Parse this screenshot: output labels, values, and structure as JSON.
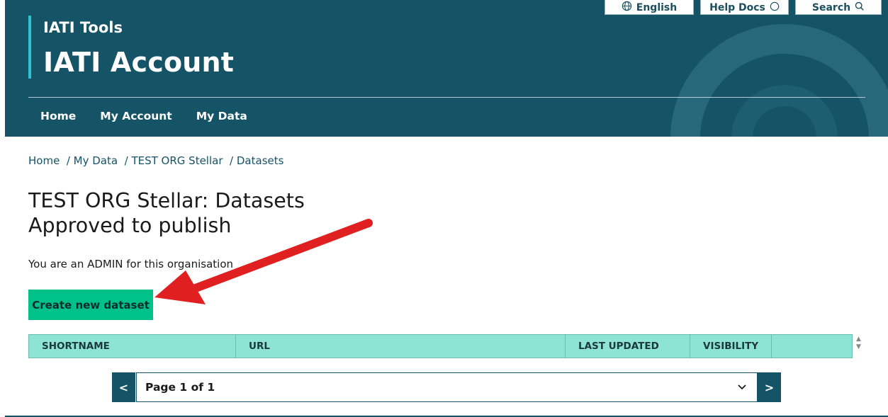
{
  "header": {
    "top_buttons": {
      "language": "English",
      "help": "Help Docs",
      "search": "Search"
    },
    "tools_label": "IATI Tools",
    "account_label": "IATI Account",
    "nav": [
      "Home",
      "My Account",
      "My Data"
    ]
  },
  "breadcrumb": [
    "Home",
    "My Data",
    "TEST ORG Stellar",
    "Datasets"
  ],
  "page_title": [
    "TEST ORG Stellar: Datasets",
    "Approved to publish"
  ],
  "role_text": "You are an ADMIN for this organisation",
  "create_button": "Create new dataset",
  "table": {
    "columns": [
      "SHORTNAME",
      "URL",
      "LAST UPDATED",
      "VISIBILITY",
      ""
    ]
  },
  "pager": {
    "prev": "<",
    "current": "Page 1 of 1",
    "next": ">"
  },
  "icons": {
    "language": "globe-icon",
    "help": "question-circle-icon",
    "search": "search-icon",
    "dropdown": "chevron-down-icon"
  },
  "colors": {
    "header_bg": "#155366",
    "accent": "#2ec4cf",
    "primary_button": "#00c18a",
    "table_header": "#8ee4d4",
    "annotation_arrow": "#e02020"
  }
}
